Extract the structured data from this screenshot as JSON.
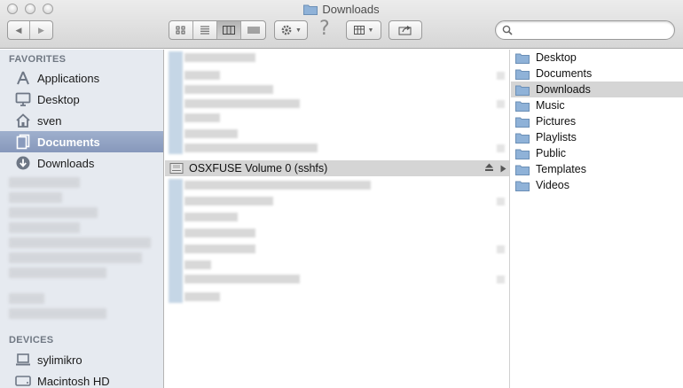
{
  "window": {
    "title": "Downloads"
  },
  "toolbar": {
    "back_glyph": "◀",
    "forward_glyph": "▶",
    "view_mode_selected": "columns",
    "help_glyph": "?",
    "search_placeholder": ""
  },
  "sidebar": {
    "favorites_header": "FAVORITES",
    "favorites": [
      {
        "label": "Applications",
        "icon": "applications-icon"
      },
      {
        "label": "Desktop",
        "icon": "desktop-icon"
      },
      {
        "label": "sven",
        "icon": "home-icon"
      },
      {
        "label": "Documents",
        "icon": "documents-icon",
        "selected": true
      },
      {
        "label": "Downloads",
        "icon": "downloads-icon"
      }
    ],
    "devices_header": "DEVICES",
    "devices": [
      {
        "label": "sylimikro",
        "icon": "laptop-icon"
      },
      {
        "label": "Macintosh HD",
        "icon": "harddisk-icon"
      }
    ]
  },
  "middle_column": {
    "selected_item": "OSXFUSE Volume 0 (sshfs)"
  },
  "right_column": {
    "items": [
      {
        "label": "Desktop"
      },
      {
        "label": "Documents"
      },
      {
        "label": "Downloads",
        "selected": true
      },
      {
        "label": "Music"
      },
      {
        "label": "Pictures"
      },
      {
        "label": "Playlists"
      },
      {
        "label": "Public"
      },
      {
        "label": "Templates"
      },
      {
        "label": "Videos"
      }
    ]
  },
  "colors": {
    "folder_blue": "#7fa6d0",
    "sidebar_bg": "#e6eaf0",
    "sidebar_selection": "#8f9fc2",
    "row_selection": "#d5d5d5"
  }
}
